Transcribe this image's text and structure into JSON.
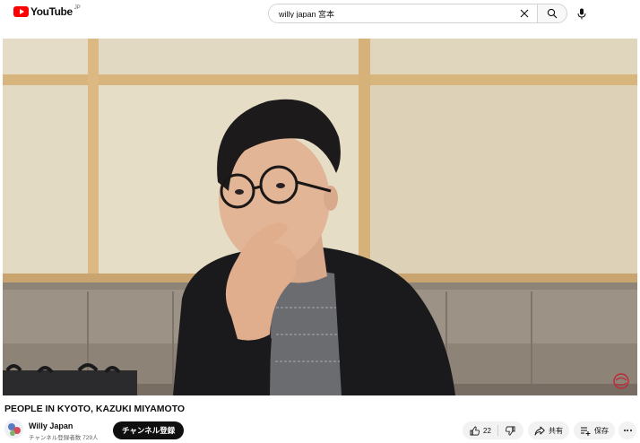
{
  "header": {
    "logo_text": "YouTube",
    "logo_region": "JP",
    "search_value": "willy japan 宮本",
    "brand_color": "#ff0000"
  },
  "video": {
    "title": "PEOPLE IN KYOTO, KAZUKI MIYAMOTO"
  },
  "channel": {
    "name": "Willy Japan",
    "subscribers": "チャンネル登録者数 729人",
    "subscribe_label": "チャンネル登録"
  },
  "actions": {
    "like_count": "22",
    "share_label": "共有",
    "save_label": "保存"
  }
}
